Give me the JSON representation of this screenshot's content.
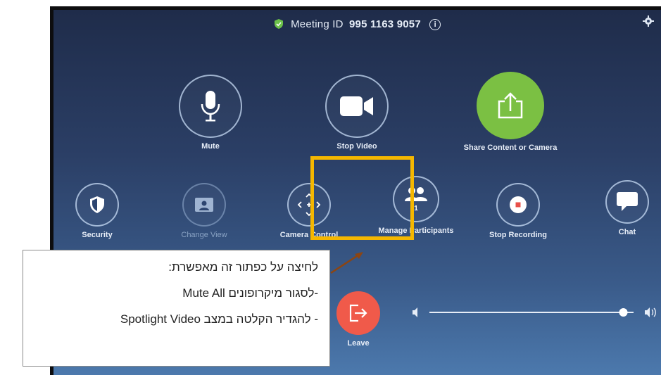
{
  "meeting": {
    "label": "Meeting ID",
    "id": "995 1163 9057",
    "info_icon": "info-icon",
    "secure_icon": "shield-check-icon"
  },
  "settings_icon": "gear-icon",
  "controls_top": [
    {
      "label": "Mute",
      "icon": "microphone-icon"
    },
    {
      "label": "Stop Video",
      "icon": "video-camera-icon"
    },
    {
      "label": "Share Content or Camera",
      "icon": "share-upload-icon",
      "color": "#7bc043"
    }
  ],
  "controls_mid": [
    {
      "label": "Security",
      "icon": "shield-icon"
    },
    {
      "label": "Change View",
      "icon": "gallery-view-icon"
    },
    {
      "label": "Camera Control",
      "icon": "camera-control-arrows-icon"
    },
    {
      "label": "Manage Participants",
      "icon": "participants-icon",
      "count": "1"
    },
    {
      "label": "Stop Recording",
      "icon": "record-stop-icon"
    },
    {
      "label": "Chat",
      "icon": "chat-bubble-icon"
    }
  ],
  "leave": {
    "label": "Leave",
    "icon": "exit-icon",
    "color": "#f05a4a"
  },
  "volume": {
    "level": 0.95,
    "low_icon": "volume-low-icon",
    "high_icon": "volume-high-icon"
  },
  "highlight_color": "#f5b700",
  "callout": {
    "line1": "לחיצה על כפתור זה מאפשרת:",
    "line2": "-לסגור מיקרופונים Mute All",
    "line3": "- להגדיר הקלטה במצב Spotlight Video"
  }
}
